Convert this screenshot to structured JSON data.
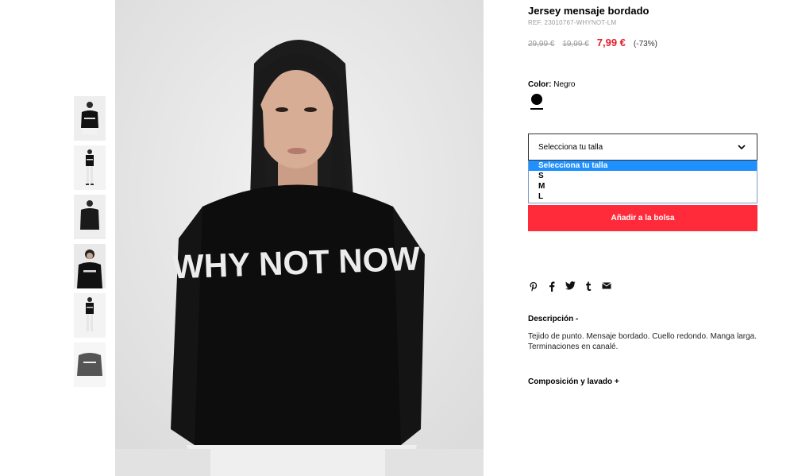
{
  "product": {
    "title": "Jersey mensaje bordado",
    "ref": "REF. 23010767-WHYNOT-LM",
    "old_price_1": "29,99 €",
    "old_price_2": "19,99 €",
    "sale_price": "7,99 €",
    "discount": "(-73%)",
    "color_label": "Color:",
    "color_value": "Negro",
    "sweater_print": "WHY NOT NOW"
  },
  "size_selector": {
    "placeholder": "Selecciona tu talla",
    "options": [
      "Selecciona tu talla",
      "S",
      "M",
      "L"
    ]
  },
  "add_to_bag": "Añadir a la bolsa",
  "share_icons": [
    "pinterest-icon",
    "facebook-icon",
    "twitter-icon",
    "tumblr-icon",
    "email-icon"
  ],
  "description": {
    "title": "Descripción -",
    "body": "Tejido de punto. Mensaje bordado. Cuello redondo. Manga larga. Terminaciones en canalé."
  },
  "composition": {
    "title": "Composición y lavado +"
  },
  "colors": {
    "sale": "#e0202b",
    "button": "#ff2b3a",
    "selected_option": "#1e90ff"
  }
}
